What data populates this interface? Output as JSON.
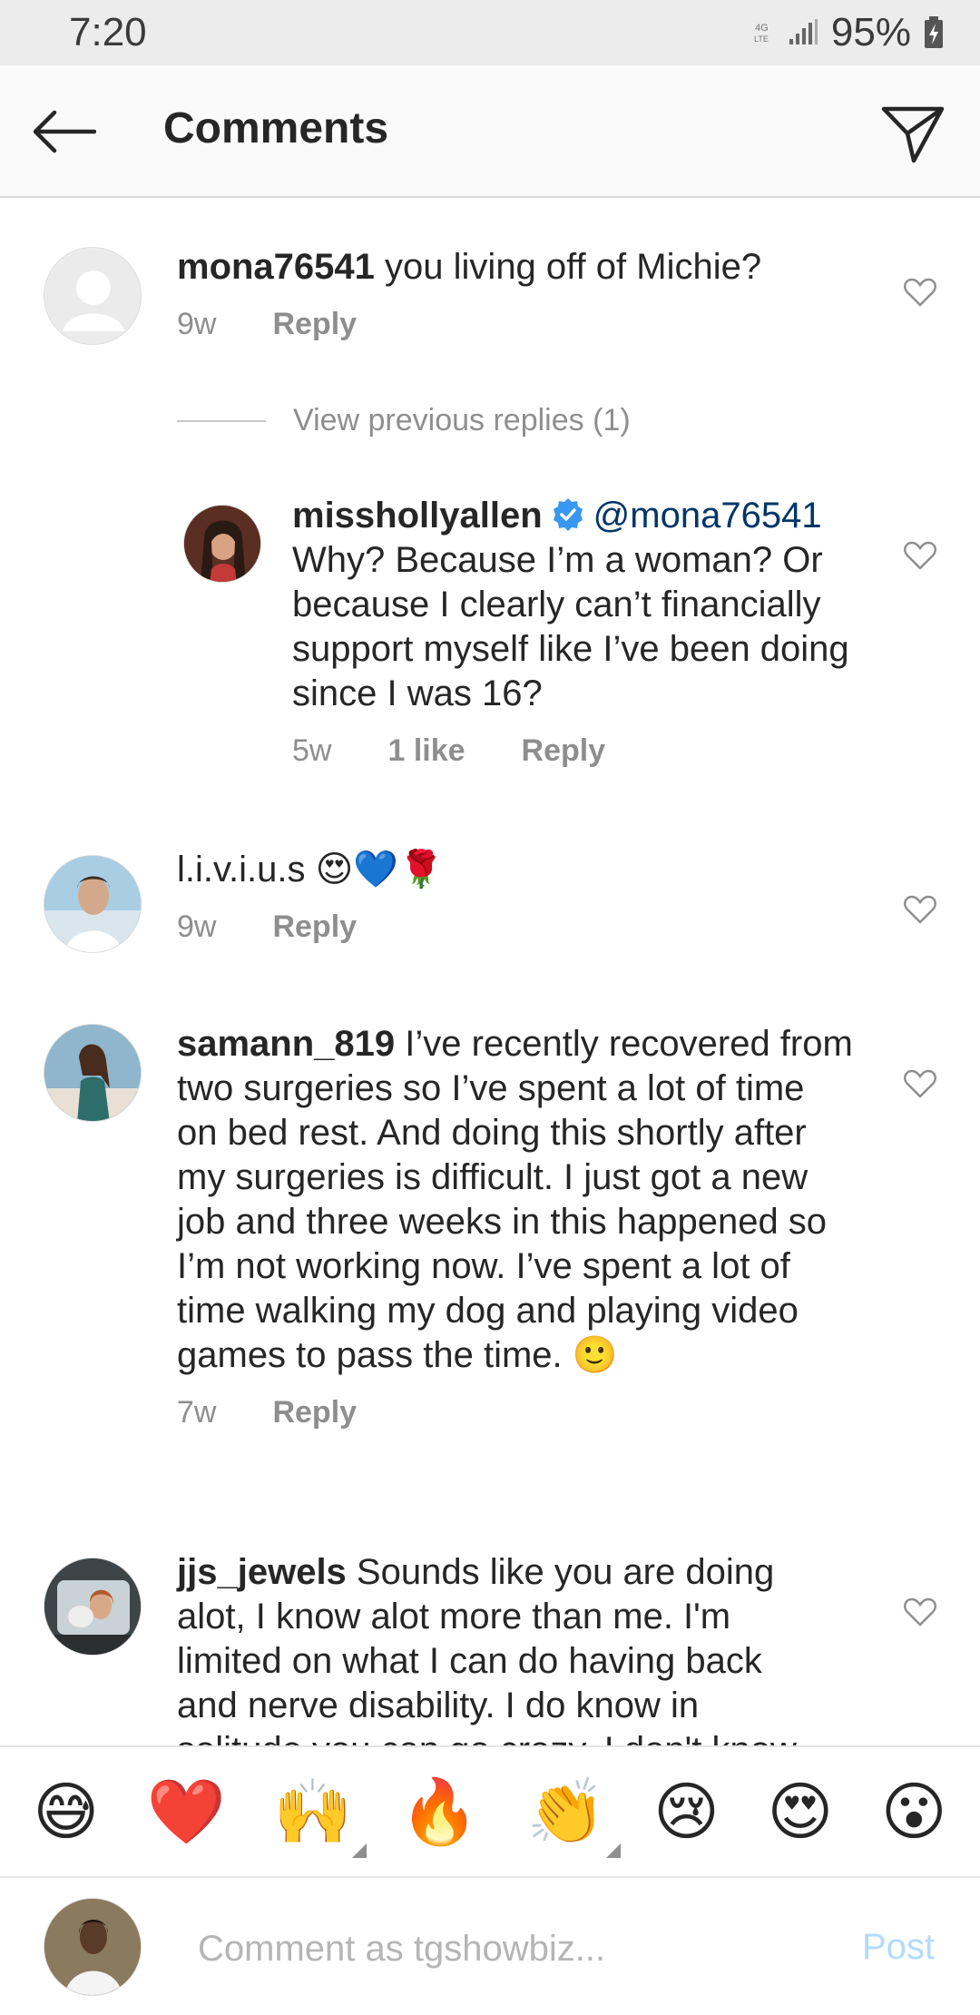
{
  "status": {
    "time": "7:20",
    "battery": "95%",
    "network": "LTE"
  },
  "header": {
    "title": "Comments"
  },
  "view_replies_text": "View previous replies (1)",
  "comments": [
    {
      "username": "mona76541",
      "text": "you living off of Michie?",
      "time": "9w",
      "reply_label": "Reply"
    },
    {
      "username": "misshollyallen",
      "mention": "@mona76541",
      "text": "Why? Because I’m a woman? Or because I clearly can’t financially support myself like I’ve been doing since I was 16?",
      "time": "5w",
      "likes": "1 like",
      "reply_label": "Reply"
    },
    {
      "username": "l.i.v.i.u.s",
      "text": "😍💙🌹",
      "time": "9w",
      "reply_label": "Reply"
    },
    {
      "username": "samann_819",
      "text": "I’ve recently recovered from two surgeries so I’ve spent a lot of time on bed rest. And doing this shortly after my surgeries is difficult. I just got a new job and three weeks in this happened so I’m not working now. I’ve spent a lot of time walking my dog and playing video games to pass the time. 🙂",
      "time": "7w",
      "reply_label": "Reply"
    },
    {
      "username": "jjs_jewels",
      "text": "Sounds like you are doing alot, I know alot more than me. I'm limited on what I can do having back and nerve disability. I do know in solitude you can go crazy. I don't know"
    }
  ],
  "emoji_bar": [
    "😅",
    "❤️",
    "🙌",
    "🔥",
    "👏",
    "😢",
    "😍",
    "😮"
  ],
  "composer": {
    "placeholder": "Comment as tgshowbiz...",
    "post_label": "Post"
  },
  "colors": {
    "text": "#262626",
    "muted": "#8e8e8e",
    "mention": "#003569",
    "verified": "#3897f0",
    "post_disabled": "#b3dbff"
  }
}
